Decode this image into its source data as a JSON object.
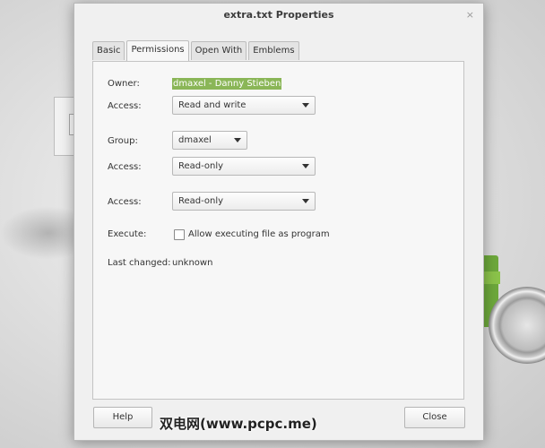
{
  "window": {
    "title": "extra.txt Properties",
    "close_symbol": "×"
  },
  "tabs": [
    {
      "label": "Basic"
    },
    {
      "label": "Permissions",
      "active": true
    },
    {
      "label": "Open With"
    },
    {
      "label": "Emblems"
    }
  ],
  "permissions": {
    "owner_label": "Owner:",
    "owner_value": "dmaxel - Danny Stieben",
    "owner_access_label": "Access:",
    "owner_access_value": "Read and write",
    "group_label": "Group:",
    "group_value": "dmaxel",
    "group_access_label": "Access:",
    "group_access_value": "Read-only",
    "others_access_label": "Access:",
    "others_access_value": "Read-only",
    "execute_label": "Execute:",
    "execute_checkbox_label": "Allow executing file as program",
    "execute_checked": false,
    "last_changed_label": "Last changed:",
    "last_changed_value": "unknown"
  },
  "footer": {
    "help_label": "Help",
    "close_label": "Close"
  },
  "watermark": "双电网(www.pcpc.me)",
  "colors": {
    "selection_highlight": "#8ab657",
    "mint_green": "#6da83b"
  }
}
